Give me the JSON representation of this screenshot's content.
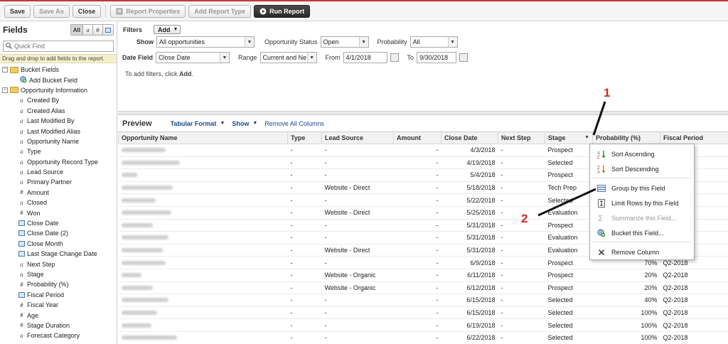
{
  "toolbar": {
    "save": "Save",
    "save_as": "Save As",
    "close": "Close",
    "report_properties": "Report Properties",
    "add_report_type": "Add Report Type",
    "run_report": "Run Report"
  },
  "fields_panel": {
    "title": "Fields",
    "filter_tabs": [
      "All",
      "a",
      "#",
      ""
    ],
    "quick_find_placeholder": "Quick Find",
    "hint": "Drag and drop to add fields to the report.",
    "bucket_folder": "Bucket Fields",
    "add_bucket_field": "Add Bucket Field",
    "opp_folder": "Opportunity Information",
    "items": [
      {
        "label": "Created By",
        "type": "text"
      },
      {
        "label": "Created Alias",
        "type": "text"
      },
      {
        "label": "Last Modified By",
        "type": "text"
      },
      {
        "label": "Last Modified Alias",
        "type": "text"
      },
      {
        "label": "Opportunity Name",
        "type": "text"
      },
      {
        "label": "Type",
        "type": "text"
      },
      {
        "label": "Opportunity Record Type",
        "type": "text"
      },
      {
        "label": "Lead Source",
        "type": "text"
      },
      {
        "label": "Primary Partner",
        "type": "text"
      },
      {
        "label": "Amount",
        "type": "number"
      },
      {
        "label": "Closed",
        "type": "text"
      },
      {
        "label": "Won",
        "type": "number"
      },
      {
        "label": "Close Date",
        "type": "date"
      },
      {
        "label": "Close Date (2)",
        "type": "date"
      },
      {
        "label": "Close Month",
        "type": "date"
      },
      {
        "label": "Last Stage Change Date",
        "type": "date"
      },
      {
        "label": "Next Step",
        "type": "text"
      },
      {
        "label": "Stage",
        "type": "text"
      },
      {
        "label": "Probability (%)",
        "type": "number"
      },
      {
        "label": "Fiscal Period",
        "type": "date"
      },
      {
        "label": "Fiscal Year",
        "type": "number"
      },
      {
        "label": "Age",
        "type": "number"
      },
      {
        "label": "Stage Duration",
        "type": "number"
      },
      {
        "label": "Forecast Category",
        "type": "text"
      }
    ]
  },
  "filters": {
    "filters_label": "Filters",
    "add_button": "Add",
    "show_label": "Show",
    "show_value": "All opportunities",
    "opp_status_label": "Opportunity Status",
    "opp_status_value": "Open",
    "probability_label": "Probability",
    "probability_value": "All",
    "date_field_label": "Date Field",
    "date_field_value": "Close Date",
    "range_label": "Range",
    "range_value": "Current and Ne",
    "from_label": "From",
    "from_value": "4/1/2018",
    "to_label": "To",
    "to_value": "9/30/2018",
    "add_hint_prefix": "To add filters, click ",
    "add_hint_bold": "Add",
    "add_hint_suffix": "."
  },
  "preview": {
    "title": "Preview",
    "format": "Tabular Format",
    "show": "Show",
    "remove_all": "Remove All Columns",
    "columns": [
      "Opportunity Name",
      "Type",
      "Lead Source",
      "Amount",
      "Close Date",
      "Next Step",
      "Stage",
      "Probability (%)",
      "Fiscal Period"
    ],
    "rows": [
      {
        "type": "-",
        "lead": "-",
        "amount": "-",
        "close": "4/3/2018",
        "next": "-",
        "stage": "Prospect",
        "prob": "",
        "period": "2018"
      },
      {
        "type": "-",
        "lead": "-",
        "amount": "-",
        "close": "4/19/2018",
        "next": "-",
        "stage": "Selected",
        "prob": "",
        "period": "2018"
      },
      {
        "type": "-",
        "lead": "-",
        "amount": "-",
        "close": "5/4/2018",
        "next": "-",
        "stage": "Prospect",
        "prob": "",
        "period": "2018"
      },
      {
        "type": "-",
        "lead": "Website - Direct",
        "amount": "-",
        "close": "5/18/2018",
        "next": "-",
        "stage": "Tech Prep",
        "prob": "",
        "period": "2018"
      },
      {
        "type": "-",
        "lead": "-",
        "amount": "-",
        "close": "5/22/2018",
        "next": "-",
        "stage": "Selected",
        "prob": "",
        "period": "2018"
      },
      {
        "type": "-",
        "lead": "Website - Direct",
        "amount": "-",
        "close": "5/25/2018",
        "next": "-",
        "stage": "Evaluation",
        "prob": "",
        "period": "2018"
      },
      {
        "type": "-",
        "lead": "-",
        "amount": "-",
        "close": "5/31/2018",
        "next": "-",
        "stage": "Prospect",
        "prob": "",
        "period": "2018"
      },
      {
        "type": "-",
        "lead": "-",
        "amount": "-",
        "close": "5/31/2018",
        "next": "-",
        "stage": "Evaluation",
        "prob": "",
        "period": "2018"
      },
      {
        "type": "-",
        "lead": "Website - Direct",
        "amount": "-",
        "close": "5/31/2018",
        "next": "-",
        "stage": "Evaluation",
        "prob": "",
        "period": "2018"
      },
      {
        "type": "-",
        "lead": "-",
        "amount": "-",
        "close": "6/9/2018",
        "next": "-",
        "stage": "Prospect",
        "prob": "70%",
        "period": "Q2-2018"
      },
      {
        "type": "-",
        "lead": "Website - Organic",
        "amount": "-",
        "close": "6/11/2018",
        "next": "-",
        "stage": "Prospect",
        "prob": "20%",
        "period": "Q2-2018"
      },
      {
        "type": "-",
        "lead": "Website - Organic",
        "amount": "-",
        "close": "6/12/2018",
        "next": "-",
        "stage": "Prospect",
        "prob": "20%",
        "period": "Q2-2018"
      },
      {
        "type": "-",
        "lead": "-",
        "amount": "-",
        "close": "6/15/2018",
        "next": "-",
        "stage": "Selected",
        "prob": "40%",
        "period": "Q2-2018"
      },
      {
        "type": "-",
        "lead": "-",
        "amount": "-",
        "close": "6/15/2018",
        "next": "-",
        "stage": "Selected",
        "prob": "100%",
        "period": "Q2-2018"
      },
      {
        "type": "-",
        "lead": "-",
        "amount": "-",
        "close": "6/19/2018",
        "next": "-",
        "stage": "Selected",
        "prob": "100%",
        "period": "Q2-2018"
      },
      {
        "type": "-",
        "lead": "-",
        "amount": "-",
        "close": "6/22/2018",
        "next": "-",
        "stage": "Selected",
        "prob": "100%",
        "period": "Q2-2018"
      }
    ]
  },
  "context_menu": {
    "items": [
      {
        "label": "Sort Ascending",
        "icon": "sort-ascending-icon",
        "enabled": true
      },
      {
        "label": "Sort Descending",
        "icon": "sort-descending-icon",
        "enabled": true
      },
      {
        "label": "Group by this Field",
        "icon": "group-icon",
        "enabled": true
      },
      {
        "label": "Limit Rows by this Field",
        "icon": "limit-rows-icon",
        "enabled": true
      },
      {
        "label": "Summarize this Field...",
        "icon": "sigma-icon",
        "enabled": false
      },
      {
        "label": "Bucket this Field...",
        "icon": "bucket-icon",
        "enabled": true
      },
      {
        "label": "Remove Column",
        "icon": "close-icon",
        "enabled": true
      }
    ]
  },
  "annotations": {
    "one": "1",
    "two": "2",
    "color": "#d3271f"
  }
}
